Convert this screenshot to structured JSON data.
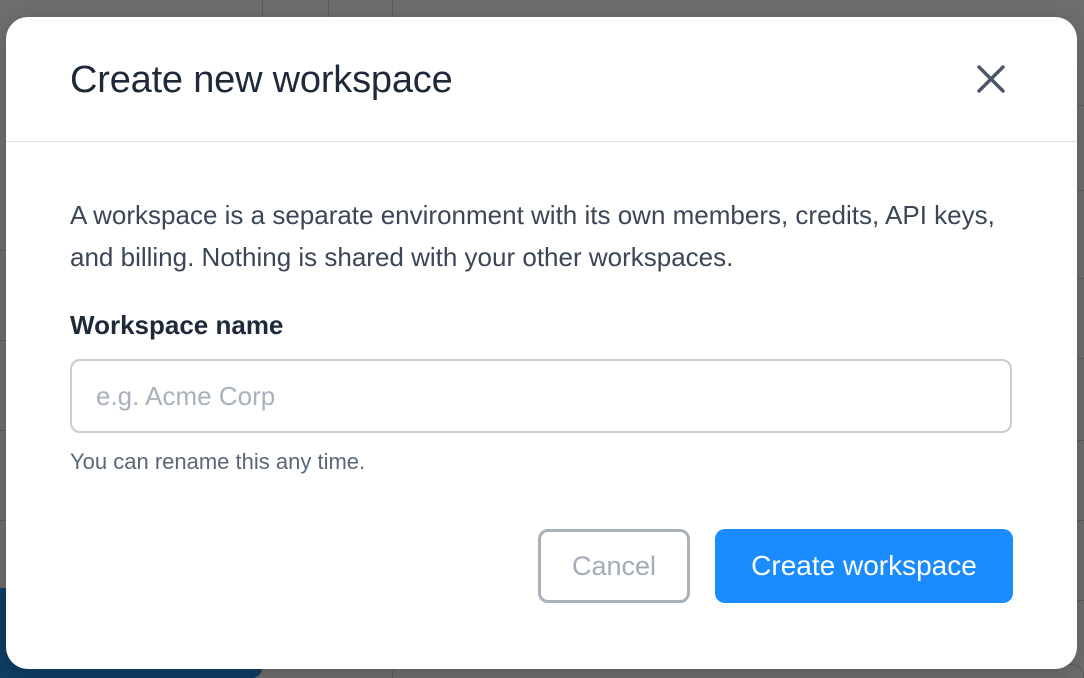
{
  "dialog": {
    "title": "Create new workspace",
    "close_icon": "close-icon",
    "description": "A workspace is a separate environment with its own members, credits, API keys, and billing. Nothing is shared with your other workspaces.",
    "field": {
      "label": "Workspace name",
      "value": "",
      "placeholder": "e.g. Acme Corp",
      "help": "You can rename this any time."
    },
    "actions": {
      "cancel_label": "Cancel",
      "create_label": "Create workspace"
    }
  },
  "colors": {
    "primary": "#1a8cff",
    "title_text": "#1e2a3a",
    "body_text": "#3b4656",
    "muted_text": "#5b6676",
    "placeholder": "#a8b1bc",
    "border": "#c7ced6",
    "overlay": "#6e6e6e"
  }
}
